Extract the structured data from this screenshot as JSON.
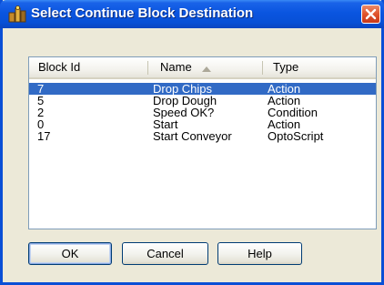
{
  "window": {
    "title": "Select Continue Block Destination"
  },
  "list": {
    "columns": [
      "Block Id",
      "Name",
      "Type"
    ],
    "sort_column": "Name",
    "sort_direction": "ascending",
    "rows": [
      {
        "id": "7",
        "name": "Drop Chips",
        "type": "Action",
        "selected": true
      },
      {
        "id": "5",
        "name": "Drop Dough",
        "type": "Action",
        "selected": false
      },
      {
        "id": "2",
        "name": "Speed OK?",
        "type": "Condition",
        "selected": false
      },
      {
        "id": "0",
        "name": "Start",
        "type": "Action",
        "selected": false
      },
      {
        "id": "17",
        "name": "Start Conveyor",
        "type": "OptoScript",
        "selected": false
      }
    ]
  },
  "buttons": {
    "ok": "OK",
    "cancel": "Cancel",
    "help": "Help"
  },
  "colors": {
    "titlebar": "#0a55e0",
    "selection": "#316ac5",
    "dialog_bg": "#ece9d8",
    "close": "#e0542c"
  },
  "icons": {
    "title": "flowchart-app-icon",
    "close": "close-icon",
    "sort": "sort-ascending-icon"
  }
}
